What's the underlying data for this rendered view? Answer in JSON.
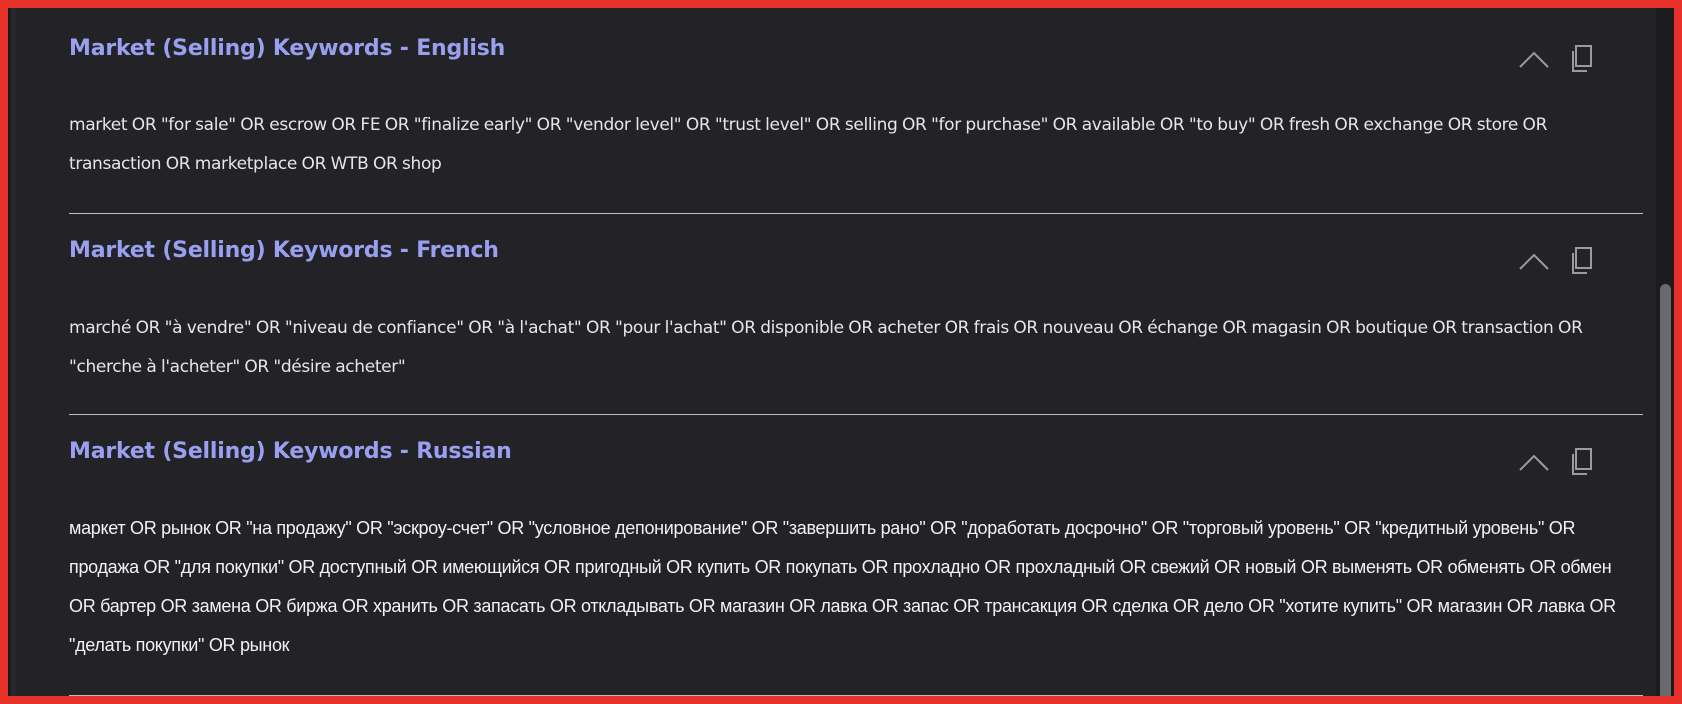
{
  "sections": [
    {
      "title": "Market (Selling) Keywords - English",
      "keywords": "market OR \"for sale\" OR escrow OR FE OR \"finalize early\" OR \"vendor level\" OR \"trust level\" OR selling OR \"for purchase\" OR available OR \"to buy\" OR fresh OR exchange OR store OR transaction OR marketplace OR WTB OR shop"
    },
    {
      "title": "Market (Selling) Keywords - French",
      "keywords": "marché OR \"à vendre\" OR \"niveau de confiance\" OR \"à l'achat\" OR \"pour l'achat\" OR disponible OR acheter OR frais OR nouveau OR échange OR magasin OR boutique OR transaction OR \"cherche à l'acheter\" OR \"désire acheter\""
    },
    {
      "title": "Market (Selling) Keywords - Russian",
      "keywords": "маркет OR рынок OR \"на продажу\" OR \"эскроу-счет\" OR \"условное депонирование\" OR \"завершить рано\" OR \"доработать досрочно\" OR \"торговый уровень\" OR \"кредитный уровень\" OR продажа OR \"для покупки\" OR доступный OR имеющийся OR пригодный OR купить OR покупать OR прохладно OR прохладный OR свежий OR новый OR выменять OR обменять OR обмен OR бартер OR замена OR биржа OR хранить OR запасать OR откладывать OR магазин OR лавка OR запас OR трансакция OR сделка OR дело OR \"хотите купить\" OR магазин OR лавка OR \"делать покупки\" OR рынок"
    }
  ],
  "icons": {
    "collapse": "chevron-up-icon",
    "copy": "copy-icon"
  },
  "colors": {
    "background": "#232327",
    "title": "#9aa0f0",
    "text": "#e6e6e8",
    "divider": "#bdbdc2",
    "icon": "#9a9aa0",
    "frame": "#e8302a"
  }
}
